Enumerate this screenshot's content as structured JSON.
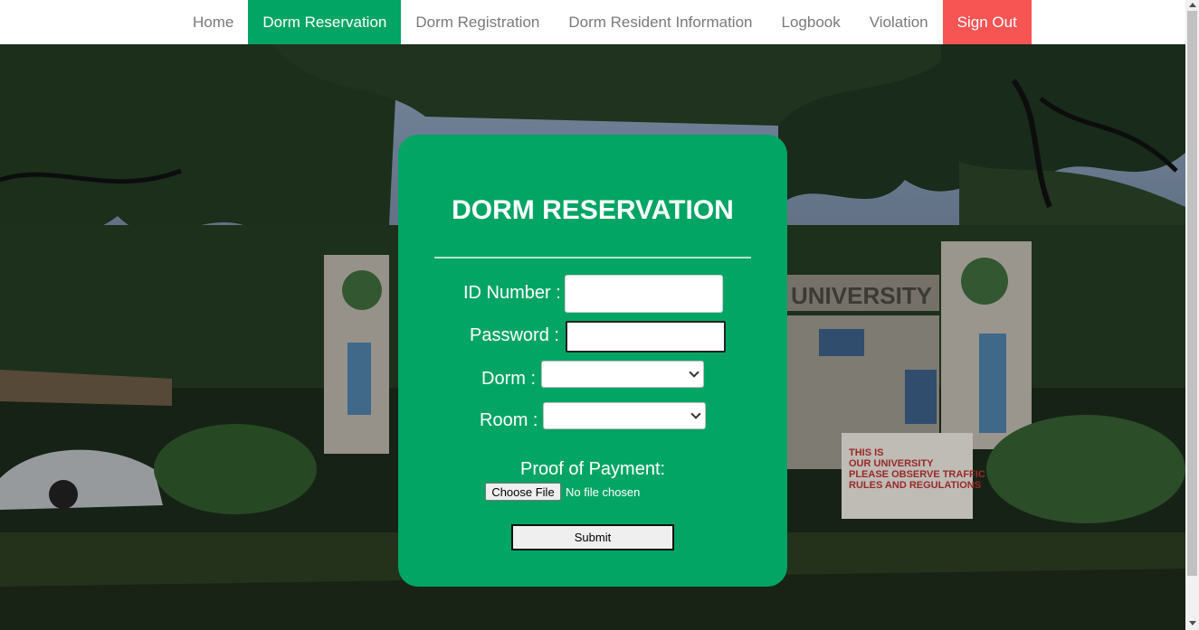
{
  "nav": {
    "items": [
      {
        "label": "Home"
      },
      {
        "label": "Dorm Reservation"
      },
      {
        "label": "Dorm Registration"
      },
      {
        "label": "Dorm Resident Information"
      },
      {
        "label": "Logbook"
      },
      {
        "label": "Violation"
      },
      {
        "label": "Sign Out"
      }
    ],
    "active": "Dorm Reservation"
  },
  "form": {
    "title": "DORM RESERVATION",
    "id_label": "ID Number :",
    "id_value": "",
    "password_label": "Password :",
    "password_value": "",
    "dorm_label": "Dorm :",
    "dorm_selected": "",
    "room_label": "Room :",
    "room_selected": "",
    "proof_label": "Proof of Payment:",
    "file_button": "Choose File",
    "file_status": "No file chosen",
    "submit_label": "Submit"
  },
  "colors": {
    "accent": "#03a564",
    "signout": "#f75454",
    "nav_text": "#7a7a7a"
  }
}
